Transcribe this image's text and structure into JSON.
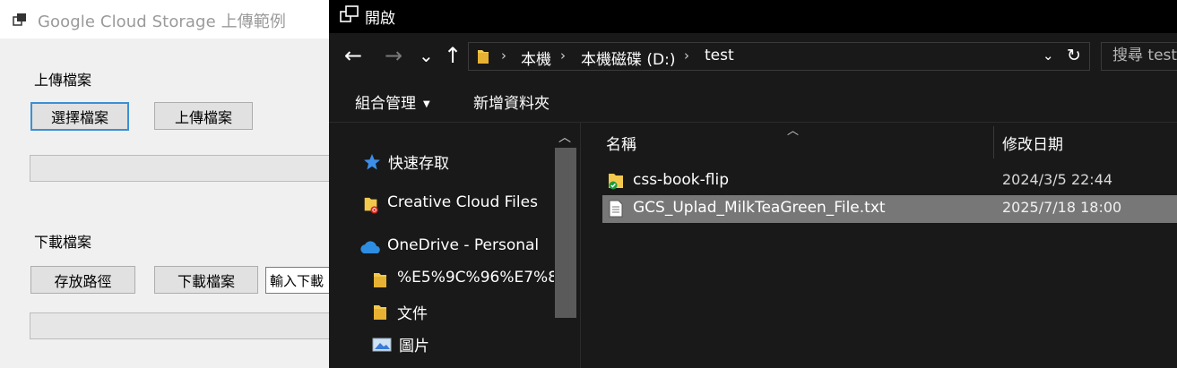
{
  "winform": {
    "title": "Google Cloud Storage 上傳範例",
    "upload_section_label": "上傳檔案",
    "select_file_button": "選擇檔案",
    "upload_button": "上傳檔案",
    "download_section_label": "下載檔案",
    "save_path_button": "存放路徑",
    "download_button": "下載檔案",
    "download_input_placeholder": "輸入下載"
  },
  "explorer": {
    "title": "開啟",
    "nav": {
      "back_glyph": "←",
      "forward_glyph": "→",
      "recent_glyph": "⌄",
      "up_glyph": "↑"
    },
    "breadcrumbs": [
      "本機",
      "本機磁碟 (D:)",
      "test"
    ],
    "search_placeholder": "搜尋 test",
    "commands": {
      "organize": "組合管理",
      "new_folder": "新增資料夾"
    },
    "nav_pane": [
      {
        "label": "快速存取",
        "icon": "star-icon"
      },
      {
        "label": "Creative Cloud Files",
        "icon": "creative-cloud-folder-icon"
      },
      {
        "label": "OneDrive - Personal",
        "icon": "onedrive-cloud-icon"
      },
      {
        "label": "%E5%9C%96%E7%8",
        "icon": "folder-icon"
      },
      {
        "label": "文件",
        "icon": "folder-icon"
      },
      {
        "label": "圖片",
        "icon": "pictures-icon"
      }
    ],
    "columns": {
      "name": "名稱",
      "modified": "修改日期"
    },
    "files": [
      {
        "name": "css-book-flip",
        "modified": "2024/3/5 22:44",
        "icon": "folder-synced-icon",
        "selected": false
      },
      {
        "name": "GCS_Uplad_MilkTeaGreen_File.txt",
        "modified": "2025/7/18 18:00",
        "icon": "text-file-icon",
        "selected": true
      }
    ],
    "colors": {
      "background": "#191919",
      "selected_row": "#777777",
      "titlebar": "#000000"
    }
  }
}
